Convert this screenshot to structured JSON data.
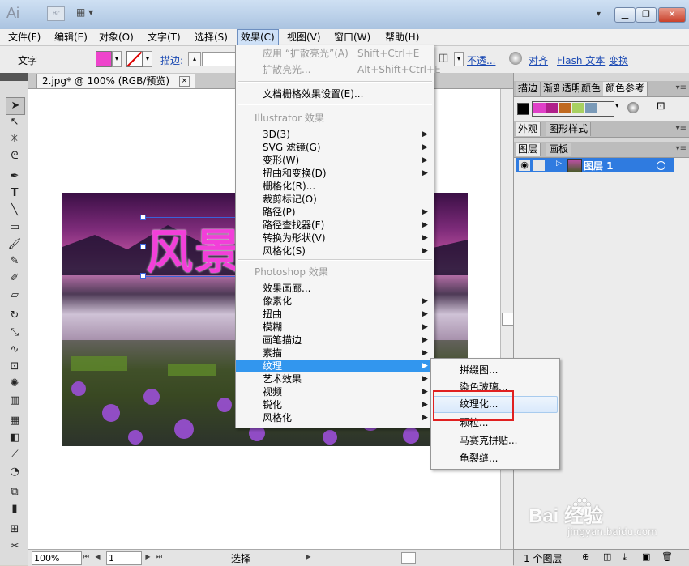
{
  "app": {
    "logo": "Ai",
    "bridge_label": "Br",
    "arrange_symbol": "▦ ▾",
    "workspace_arrow": "▾",
    "window_buttons": {
      "minimize": "▁",
      "restore": "❐",
      "close": "✕"
    }
  },
  "menubar": [
    {
      "label": "文件(F)"
    },
    {
      "label": "编辑(E)"
    },
    {
      "label": "对象(O)"
    },
    {
      "label": "文字(T)"
    },
    {
      "label": "选择(S)"
    },
    {
      "label": "效果(C)"
    },
    {
      "label": "视图(V)"
    },
    {
      "label": "窗口(W)"
    },
    {
      "label": "帮助(H)"
    }
  ],
  "control_bar": {
    "label": "文字",
    "fill_color": "#ee44cc",
    "stroke_label": "描边:",
    "opacity_label": "不透...",
    "align_label": "对齐",
    "flash_text_label": "Flash 文本",
    "transform_label": "变换"
  },
  "document": {
    "tab_title": "2.jpg* @ 100% (RGB/预览)",
    "close_symbol": "×",
    "art_text": "风景"
  },
  "status_bar": {
    "zoom": "100%",
    "page": "1",
    "status_text": "选择"
  },
  "effect_menu": {
    "items": [
      {
        "label": "应用 “扩散亮光”(A)",
        "shortcut": "Shift+Ctrl+E",
        "disabled": true
      },
      {
        "label": "扩散亮光...",
        "shortcut": "Alt+Shift+Ctrl+E",
        "disabled": true
      },
      {
        "label": "文档栅格效果设置(E)..."
      },
      {
        "label": "Illustrator 效果",
        "header": true
      },
      {
        "label": "3D(3)",
        "submenu": true
      },
      {
        "label": "SVG 滤镜(G)",
        "submenu": true
      },
      {
        "label": "变形(W)",
        "submenu": true
      },
      {
        "label": "扭曲和变换(D)",
        "submenu": true
      },
      {
        "label": "栅格化(R)..."
      },
      {
        "label": "裁剪标记(O)"
      },
      {
        "label": "路径(P)",
        "submenu": true
      },
      {
        "label": "路径查找器(F)",
        "submenu": true
      },
      {
        "label": "转换为形状(V)",
        "submenu": true
      },
      {
        "label": "风格化(S)",
        "submenu": true
      },
      {
        "label": "Photoshop 效果",
        "header": true
      },
      {
        "label": "效果画廊..."
      },
      {
        "label": "像素化",
        "submenu": true
      },
      {
        "label": "扭曲",
        "submenu": true
      },
      {
        "label": "模糊",
        "submenu": true
      },
      {
        "label": "画笔描边",
        "submenu": true
      },
      {
        "label": "素描",
        "submenu": true
      },
      {
        "label": "纹理",
        "submenu": true,
        "highlighted": true
      },
      {
        "label": "艺术效果",
        "submenu": true
      },
      {
        "label": "视频",
        "submenu": true
      },
      {
        "label": "锐化",
        "submenu": true
      },
      {
        "label": "风格化",
        "submenu": true
      }
    ]
  },
  "texture_submenu": {
    "items": [
      {
        "label": "拼缀图..."
      },
      {
        "label": "染色玻璃..."
      },
      {
        "label": "纹理化...",
        "hovered": true
      },
      {
        "label": "颗粒..."
      },
      {
        "label": "马赛克拼贴..."
      },
      {
        "label": "龟裂缝..."
      }
    ]
  },
  "right_panel": {
    "top_tabs": [
      "描边",
      "渐变",
      "透明",
      "颜色",
      "颜色参考"
    ],
    "swatch_colors": [
      "#000000",
      "#e040c8",
      "#b0208a",
      "#c06a20",
      "#a8d060",
      "#7a9ab8"
    ],
    "appearance_tabs": [
      "外观",
      "图形样式"
    ],
    "layers_tabs": [
      "图层",
      "画板"
    ],
    "layer_name": "图层 1",
    "layers_count": "1 个图层",
    "menu_symbol": "▾≡",
    "highlight_color": "#2f7be0"
  },
  "watermark": {
    "brand": "Bai  经验",
    "url": "jingyan.baidu.com"
  },
  "toolbox": {
    "tools": [
      "selection-tool",
      "direct-selection-tool",
      "magic-wand-tool",
      "lasso-tool",
      "pen-tool",
      "type-tool",
      "line-tool",
      "rectangle-tool",
      "paintbrush-tool",
      "pencil-tool",
      "blob-brush-tool",
      "eraser-tool",
      "rotate-tool",
      "scale-tool",
      "warp-tool",
      "free-transform-tool",
      "symbol-sprayer-tool",
      "graph-tool",
      "mesh-tool",
      "gradient-tool",
      "eyedropper-tool",
      "blend-tool",
      "symbol-tool",
      "column-graph-tool",
      "artboard-tool",
      "slice-tool"
    ]
  }
}
